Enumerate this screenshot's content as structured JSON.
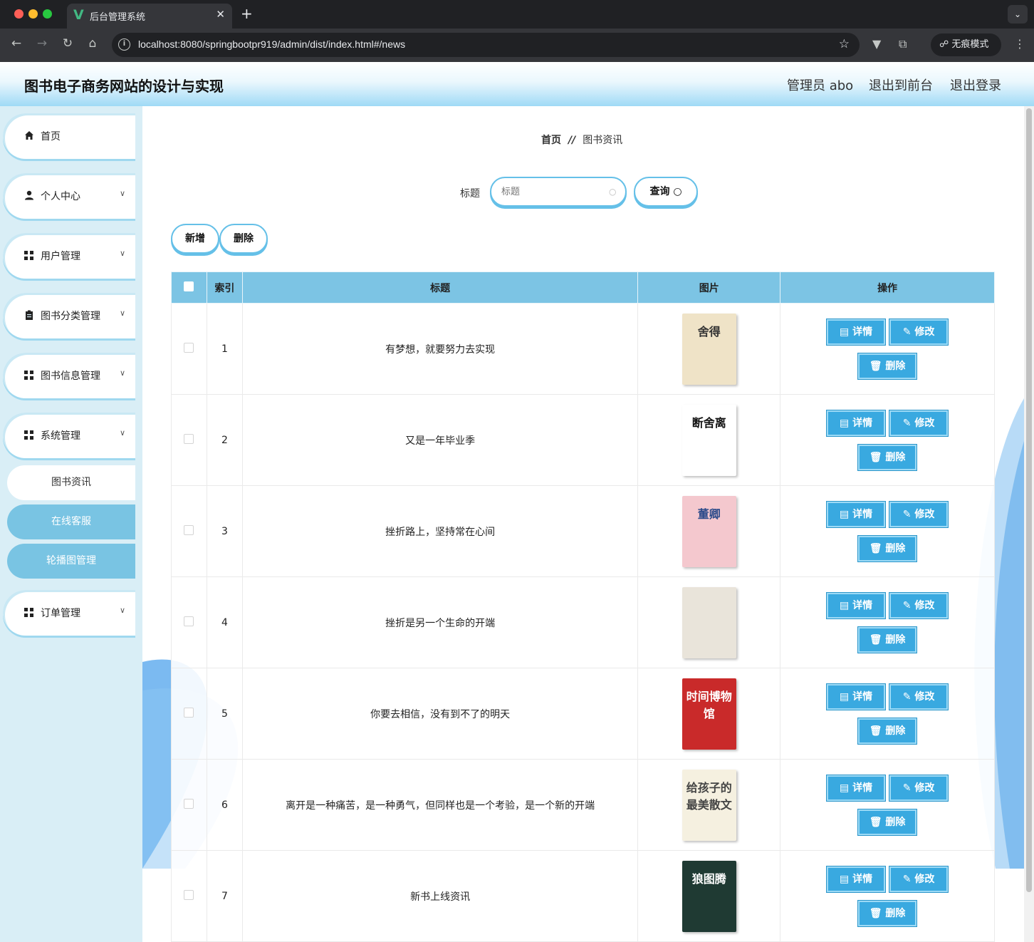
{
  "browser": {
    "tab_title": "后台管理系统",
    "url": "localhost:8080/springbootpr919/admin/dist/index.html#/news",
    "incognito_label": "无痕模式"
  },
  "header": {
    "title": "图书电子商务网站的设计与实现",
    "admin_label": "管理员 abo",
    "exit_front": "退出到前台",
    "logout": "退出登录"
  },
  "sidebar": {
    "items": [
      {
        "label": "首页",
        "icon": "home-icon"
      },
      {
        "label": "个人中心",
        "icon": "user-icon"
      },
      {
        "label": "用户管理",
        "icon": "grid-icon"
      },
      {
        "label": "图书分类管理",
        "icon": "clipboard-icon"
      },
      {
        "label": "图书信息管理",
        "icon": "grid-icon"
      },
      {
        "label": "系统管理",
        "icon": "grid-icon"
      },
      {
        "label": "订单管理",
        "icon": "grid-icon"
      }
    ],
    "sub_items": [
      {
        "label": "图书资讯",
        "active": true
      },
      {
        "label": "在线客服",
        "active": false
      },
      {
        "label": "轮播图管理",
        "active": false
      }
    ]
  },
  "breadcrumb": {
    "home": "首页",
    "sep": "//",
    "current": "图书资讯"
  },
  "search": {
    "label": "标题",
    "placeholder": "标题",
    "query_label": "查询"
  },
  "actions": {
    "add_label": "新增",
    "delete_label": "删除"
  },
  "table": {
    "columns": [
      "索引",
      "标题",
      "图片",
      "操作"
    ],
    "buttons": {
      "detail": "详情",
      "edit": "修改",
      "delete": "删除"
    },
    "rows": [
      {
        "index": "1",
        "title": "有梦想，就要努力去实现",
        "cover_text": "舍得",
        "cover_color": "#efe3c7",
        "cover_fg": "#333333"
      },
      {
        "index": "2",
        "title": "又是一年毕业季",
        "cover_text": "断舍离",
        "cover_color": "#ffffff",
        "cover_fg": "#111111"
      },
      {
        "index": "3",
        "title": "挫折路上，坚持常在心间",
        "cover_text": "董卿",
        "cover_color": "#f4c8ce",
        "cover_fg": "#2a4a8a"
      },
      {
        "index": "4",
        "title": "挫折是另一个生命的开端",
        "cover_text": "",
        "cover_color": "#e9e4da",
        "cover_fg": "#333333"
      },
      {
        "index": "5",
        "title": "你要去相信，没有到不了的明天",
        "cover_text": "时间博物馆",
        "cover_color": "#c92a2a",
        "cover_fg": "#ffffff"
      },
      {
        "index": "6",
        "title": "离开是一种痛苦，是一种勇气，但同样也是一个考验，是一个新的开端",
        "cover_text": "给孩子的最美散文",
        "cover_color": "#f5f0e0",
        "cover_fg": "#444444"
      },
      {
        "index": "7",
        "title": "新书上线资讯",
        "cover_text": "狼图腾",
        "cover_color": "#1f3a33",
        "cover_fg": "#ffffff"
      }
    ]
  }
}
